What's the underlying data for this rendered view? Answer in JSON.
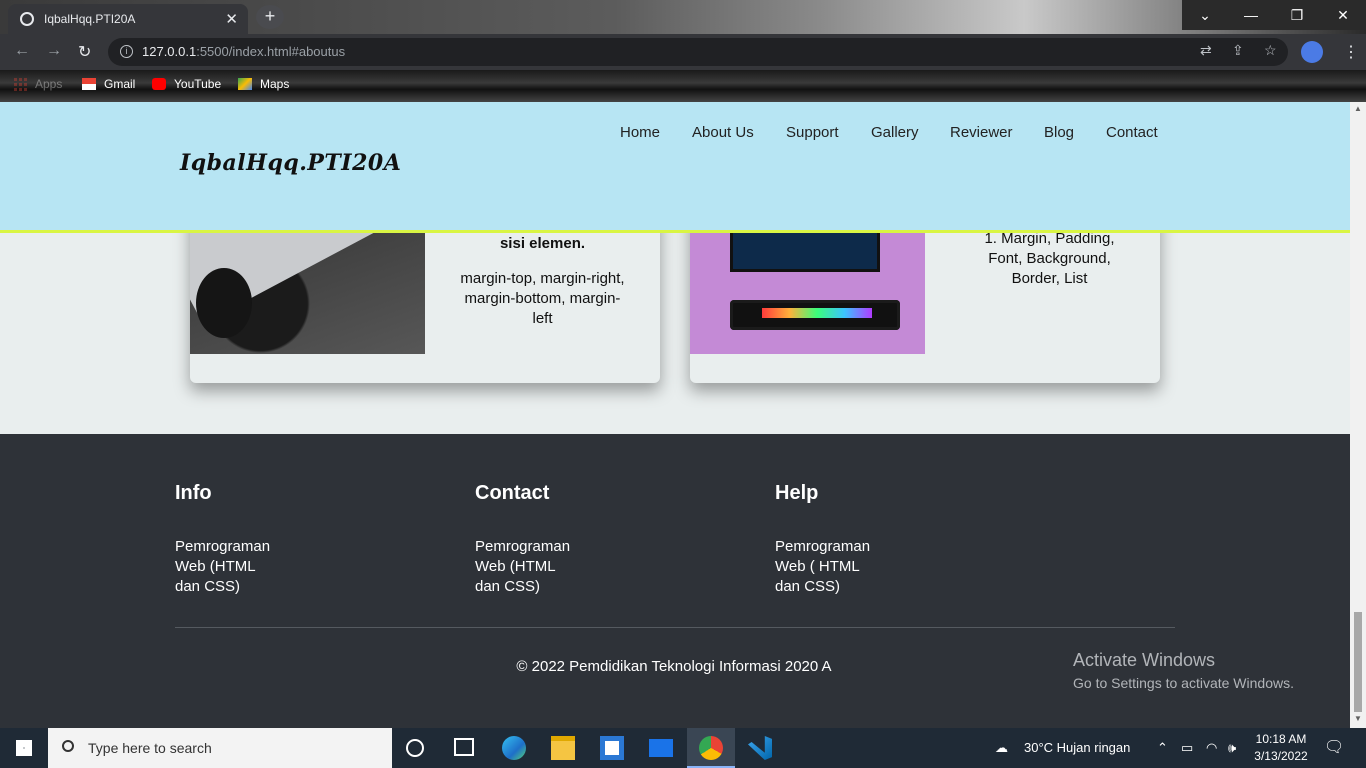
{
  "browser": {
    "tab_title": "IqbalHqq.PTI20A",
    "tab_close": "✕",
    "new_tab": "+",
    "url_host": "127.0.0.1",
    "url_rest": ":5500/index.html#aboutus",
    "window_controls": [
      "⌄",
      "—",
      "❐",
      "✕"
    ]
  },
  "bookmarks": [
    {
      "label": "Apps",
      "icon": "apps-grid-icon"
    },
    {
      "label": "Gmail",
      "icon": "gmail-icon"
    },
    {
      "label": "YouTube",
      "icon": "youtube-icon"
    },
    {
      "label": "Maps",
      "icon": "maps-icon"
    }
  ],
  "site": {
    "logo": "IqbalHqq.PTI20A",
    "nav": [
      "Home",
      "About Us",
      "Support",
      "Gallery",
      "Reviewer",
      "Blog",
      "Contact"
    ]
  },
  "cards": [
    {
      "heading": "sisi elemen.",
      "body": "margin-top, margin-right, margin-bottom, margin-left"
    },
    {
      "body": "1. Margin, Padding, Font, Background, Border, List"
    }
  ],
  "footer": {
    "columns": [
      {
        "title": "Info",
        "text": "Pemrograman Web (HTML dan CSS)"
      },
      {
        "title": "Contact",
        "text": "Pemrograman Web (HTML dan CSS)"
      },
      {
        "title": "Help",
        "text": "Pemrograman Web ( HTML dan CSS)"
      }
    ],
    "copyright": "© 2022 Pemdidikan Teknologi Informasi 2020 A"
  },
  "watermark": {
    "line1": "Activate Windows",
    "line2": "Go to Settings to activate Windows."
  },
  "taskbar": {
    "search_placeholder": "Type here to search",
    "weather": "30°C  Hujan ringan",
    "time": "10:18 AM",
    "date": "3/13/2022"
  },
  "colors": {
    "header_bg": "#b7e5f3",
    "header_border": "#d9f543",
    "footer_bg": "#2e3238",
    "page_bg": "#e9eeee"
  }
}
